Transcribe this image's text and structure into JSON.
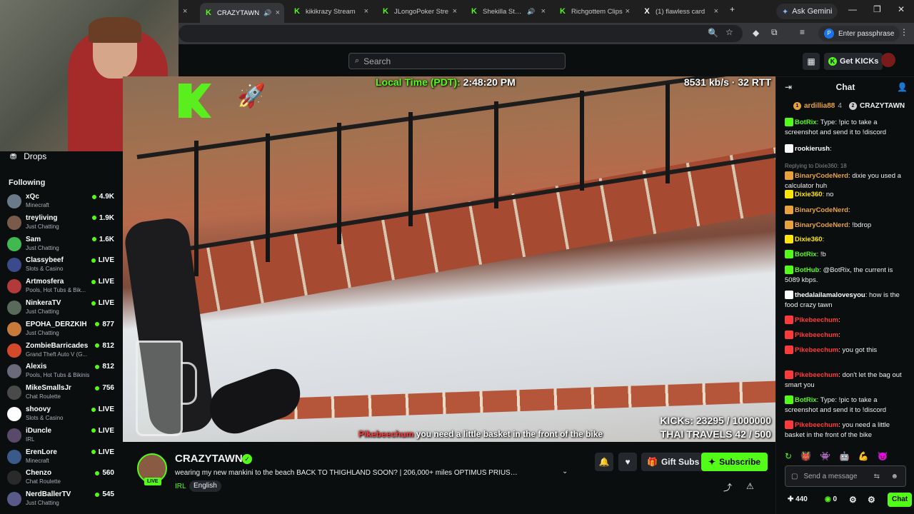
{
  "colors": {
    "accent": "#53fc18",
    "bg": "#0b0e0f",
    "red_user": "#ff3a3a"
  },
  "browser": {
    "tabs": [
      {
        "label": "CRAZYTAWN",
        "icon": "kick-icon",
        "sound": true,
        "active": true
      },
      {
        "label": "kikikrazy Stream",
        "icon": "kick-icon"
      },
      {
        "label": "JLongoPoker Stre",
        "icon": "kick-icon"
      },
      {
        "label": "Shekilla Strea",
        "icon": "kick-icon",
        "sound": true
      },
      {
        "label": "Richgottem Clips",
        "icon": "kick-icon"
      },
      {
        "label": "(1) flawless card",
        "icon": "x-icon"
      }
    ],
    "gemini": "Ask Gemini",
    "passphrase": "Enter passphrase"
  },
  "header": {
    "search_placeholder": "Search",
    "get_kicks": "Get KICKs"
  },
  "sidebar": {
    "drops": "Drops",
    "following_title": "Following",
    "items": [
      {
        "name": "xQc",
        "category": "Minecraft",
        "viewers": "4.9K",
        "color": "#6b7a88"
      },
      {
        "name": "treyliving",
        "category": "Just Chatting",
        "viewers": "1.9K",
        "color": "#7a5a4a"
      },
      {
        "name": "Sam",
        "category": "Just Chatting",
        "viewers": "1.6K",
        "color": "#3fb950"
      },
      {
        "name": "Classybeef",
        "category": "Slots & Casino",
        "viewers": "LIVE",
        "color": "#3a4a8a"
      },
      {
        "name": "Artmosfera",
        "category": "Pools, Hot Tubs & Bik...",
        "viewers": "LIVE",
        "color": "#b23a3a"
      },
      {
        "name": "NinkeraTV",
        "category": "Just Chatting",
        "viewers": "LIVE",
        "color": "#5a6a5a"
      },
      {
        "name": "EPOHA_DERZKIH",
        "category": "Just Chatting",
        "viewers": "877",
        "color": "#c77a3a"
      },
      {
        "name": "ZombieBarricades",
        "category": "Grand Theft Auto V (G...",
        "viewers": "812",
        "color": "#d24a2a"
      },
      {
        "name": "Alexis",
        "category": "Pools, Hot Tubs & Bikinis",
        "viewers": "812",
        "color": "#6a6a7a"
      },
      {
        "name": "MikeSmallsJr",
        "category": "Chat Roulette",
        "viewers": "756",
        "color": "#4a4a4a"
      },
      {
        "name": "shoovy",
        "category": "Slots & Casino",
        "viewers": "LIVE",
        "color": "#ffffff"
      },
      {
        "name": "iDuncle",
        "category": "IRL",
        "viewers": "LIVE",
        "color": "#5a4a6a"
      },
      {
        "name": "ErenLore",
        "category": "Minecraft",
        "viewers": "LIVE",
        "color": "#3a5a8a"
      },
      {
        "name": "Chenzo",
        "category": "Chat Roulette",
        "viewers": "560",
        "color": "#2a2a2a"
      },
      {
        "name": "NerdBallerTV",
        "category": "Just Chatting",
        "viewers": "545",
        "color": "#5a5a8a"
      }
    ]
  },
  "video": {
    "local_time_label": "Local Time (PDT):",
    "local_time": "2:48:20 PM",
    "bitrate": "8531 kb/s · 32 RTT",
    "kicks": "KICKs: 23295 / 1000000",
    "thai": "THAI TRAVELS 42 / 500",
    "msg_user": "Pikebeechum",
    "msg_text": "you need a little basket in the front of the bike"
  },
  "stream": {
    "channel": "CRAZYTAWN",
    "live": "LIVE",
    "title": "wearing my new mankini to the beach BACK TO THIGHLAND SOON? | 206,000+ miles OPTIMUS PRIUS | 🌡 ❤ STAK...",
    "category": "IRL",
    "language": "English",
    "gift_subs": "Gift Subs",
    "subscribe": "Subscribe"
  },
  "chat": {
    "title": "Chat",
    "pinned": [
      {
        "rank": "1",
        "name": "ardillia88",
        "count": "4"
      },
      {
        "rank": "2",
        "name": "CRAZYTAWN"
      }
    ],
    "messages": [
      {
        "user": "BotRix",
        "color": "#53fc18",
        "text": "Type: !pic to take a screenshot and send it to !discord"
      },
      {
        "user": "rookierush",
        "color": "#ffffff",
        "text": ""
      },
      {
        "reply": "Replying to Dixie360: 18",
        "user": "BinaryCodeNerd",
        "color": "#e6a23c",
        "text": "dixie you used a calculator huh"
      },
      {
        "user": "Dixie360",
        "color": "#ffe600",
        "text": "no"
      },
      {
        "user": "BinaryCodeNerd",
        "color": "#e6a23c",
        "text": ""
      },
      {
        "user": "BinaryCodeNerd",
        "color": "#e6a23c",
        "text": "!bdrop"
      },
      {
        "user": "Dixie360",
        "color": "#ffe600",
        "text": ""
      },
      {
        "user": "BotRix",
        "color": "#53fc18",
        "text": "!b"
      },
      {
        "user": "BotHub",
        "color": "#53fc18",
        "text": "@BotRix, the current is 5089 kbps."
      },
      {
        "user": "thedalailamalovesyou",
        "color": "#ffffff",
        "text": "how is the food crazy tawn"
      },
      {
        "user": "Pikebeechum",
        "color": "#ff3a3a",
        "text": ""
      },
      {
        "user": "Pikebeechum",
        "color": "#ff3a3a",
        "text": ""
      },
      {
        "user": "Pikebeechum",
        "color": "#ff3a3a",
        "text": "you got this"
      },
      {
        "user": "Pikebeechum",
        "color": "#ff3a3a",
        "text": "don't let the bag out smart you"
      },
      {
        "user": "BotRix",
        "color": "#53fc18",
        "text": "Type: !pic to take a screenshot and send it to !discord"
      },
      {
        "user": "Pikebeechum",
        "color": "#ff3a3a",
        "text": "you need a little basket in the front of the bike"
      }
    ],
    "input_placeholder": "Send a message",
    "points": "440",
    "kicks_count": "0",
    "chat_button": "Chat"
  }
}
